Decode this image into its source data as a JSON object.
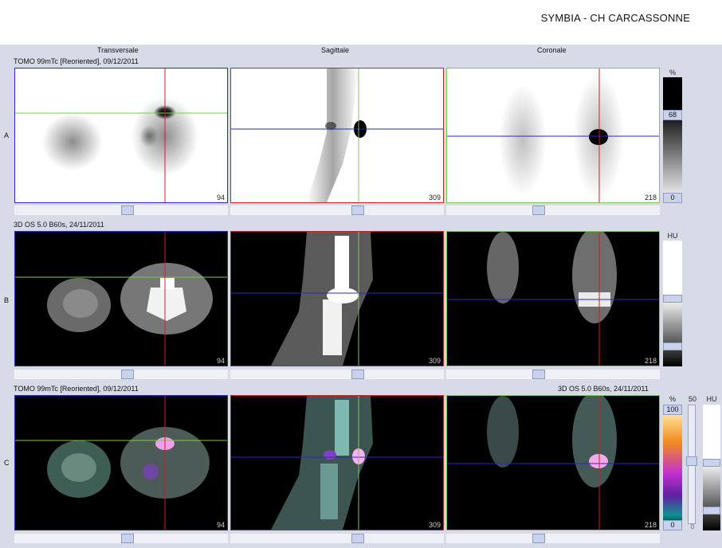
{
  "header": {
    "title": "SYMBIA - CH CARCASSONNE"
  },
  "columns": {
    "transversale": "Transversale",
    "sagittale": "Sagittale",
    "coronale": "Coronale"
  },
  "rows": {
    "a": {
      "letter": "A",
      "series": "TOMO 99mTc [Reoriented], 09/12/2011"
    },
    "b": {
      "letter": "B",
      "series": "3D  OS  5.0  B60s, 24/11/2011"
    },
    "c": {
      "letter": "C",
      "series_left": "TOMO 99mTc [Reoriented], 09/12/2011",
      "series_right": "3D  OS  5.0  B60s, 24/11/2011"
    }
  },
  "slices": {
    "transversale": "94",
    "sagittale": "309",
    "coronale": "218"
  },
  "scales": {
    "a": {
      "unit": "%",
      "max": "68",
      "min": "0"
    },
    "b": {
      "unit": "HU"
    },
    "c": {
      "unit": "%",
      "max": "100",
      "min": "0",
      "window": "50",
      "window_min": "0",
      "unit_right": "HU"
    }
  },
  "colors": {
    "cursor_red": "#cc2222",
    "cursor_green": "#7ec850",
    "cursor_blue": "#2a2ab8"
  }
}
